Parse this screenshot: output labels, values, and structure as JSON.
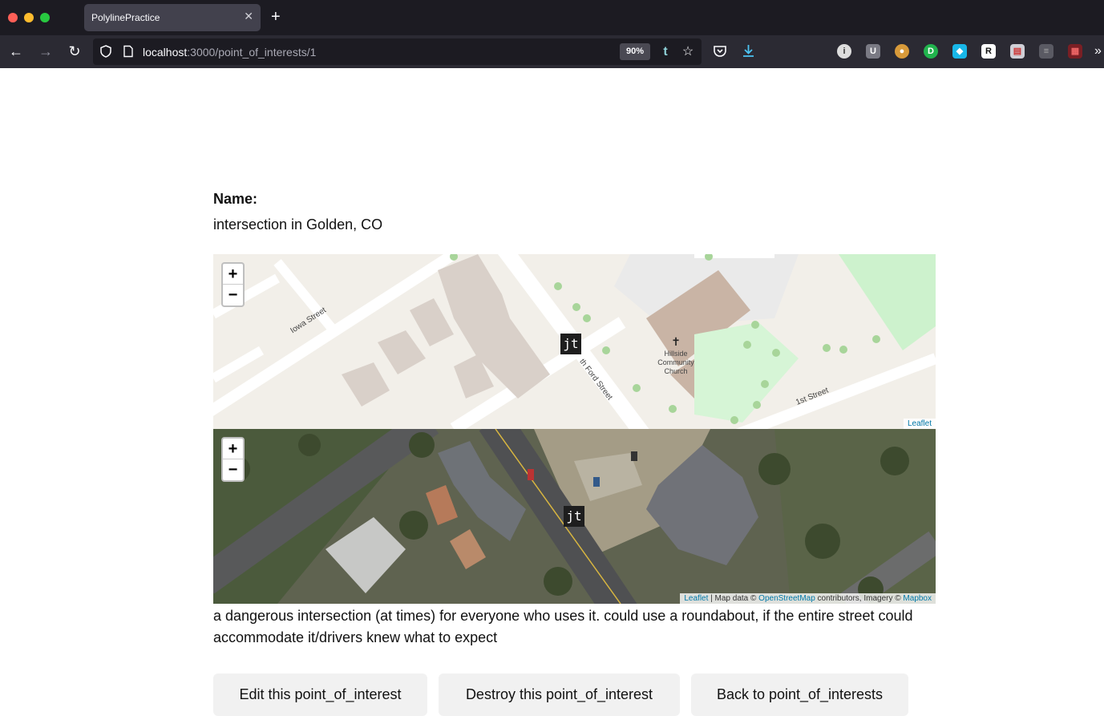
{
  "browser": {
    "tab_title": "PolylinePractice",
    "url_host": "localhost",
    "url_path": ":3000/point_of_interests/1",
    "zoom": "90%"
  },
  "page": {
    "name_label": "Name:",
    "name_value": "intersection in Golden, CO",
    "description": "a dangerous intersection (at times) for everyone who uses it. could use a roundabout, if the entire street could accommodate it/drivers knew what to expect",
    "buttons": {
      "edit": "Edit this point_of_interest",
      "destroy": "Destroy this point_of_interest",
      "back": "Back to point_of_interests"
    }
  },
  "street_map": {
    "zoom_in": "+",
    "zoom_out": "−",
    "marker": "jt",
    "labels": {
      "iowa_street": "Iowa Street",
      "ford_street": "th Ford Street",
      "first_street": "1st Street",
      "church": [
        "Hillside",
        "Community",
        "Church"
      ]
    },
    "attribution": "Leaflet"
  },
  "satellite_map": {
    "zoom_in": "+",
    "zoom_out": "−",
    "marker": "jt",
    "attribution": {
      "leaflet": "Leaflet",
      "sep": " | Map data © ",
      "osm": "OpenStreetMap",
      "contrib": " contributors, Imagery © ",
      "mapbox": "Mapbox"
    }
  }
}
